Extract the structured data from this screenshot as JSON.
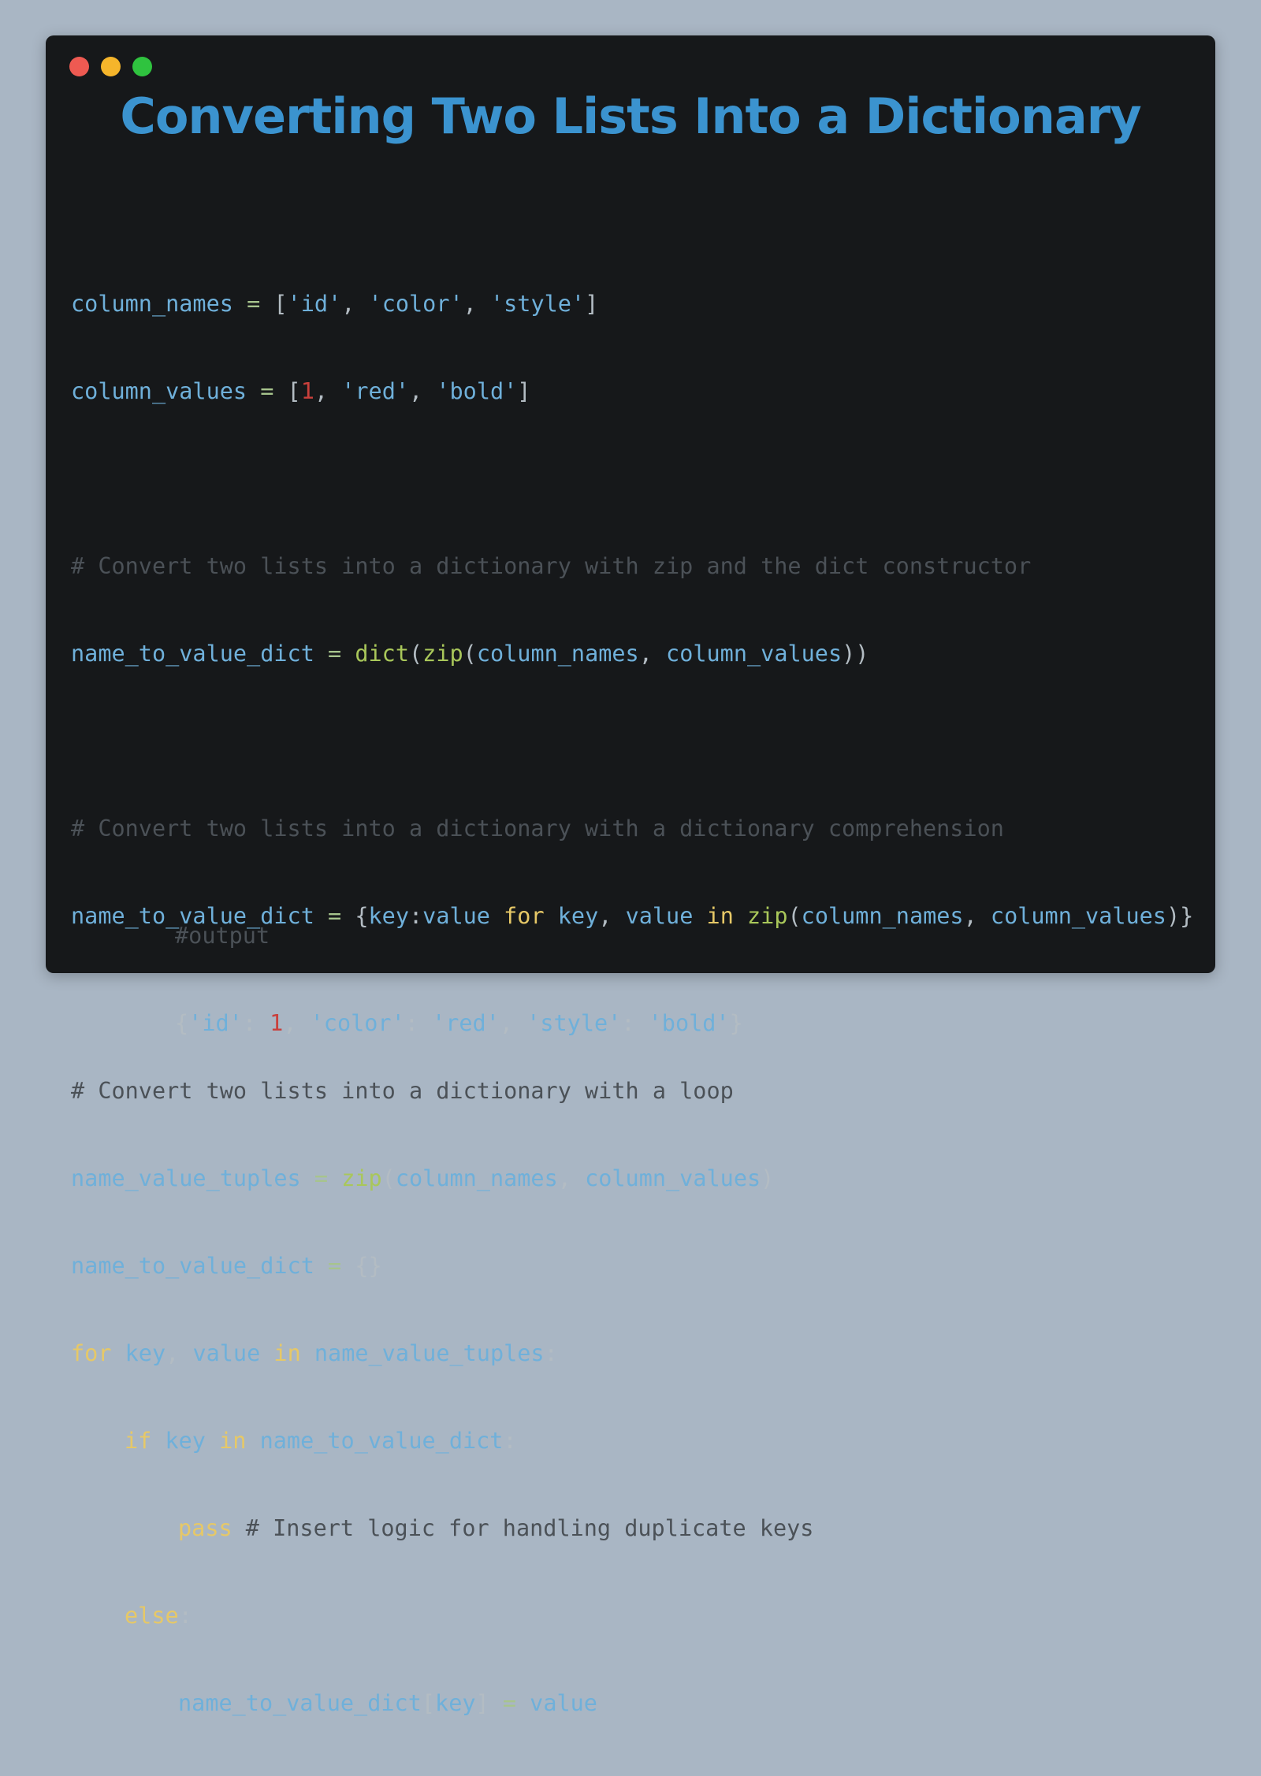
{
  "window": {
    "title": "Converting Two Lists Into a Dictionary",
    "controls": {
      "close_color": "#ee5a52",
      "minimize_color": "#f5b52b",
      "maximize_color": "#2fc33f"
    }
  },
  "code": {
    "l1": {
      "a": "column_names",
      "b": " = ",
      "c": "[",
      "d": "'id'",
      "e": ", ",
      "f": "'color'",
      "g": ", ",
      "h": "'style'",
      "i": "]"
    },
    "l2": {
      "a": "column_values",
      "b": " = ",
      "c": "[",
      "d": "1",
      "e": ", ",
      "f": "'red'",
      "g": ", ",
      "h": "'bold'",
      "i": "]"
    },
    "c1": "# Convert two lists into a dictionary with zip and the dict constructor",
    "l3": {
      "a": "name_to_value_dict",
      "b": " = ",
      "c": "dict",
      "d": "(",
      "e": "zip",
      "f": "(",
      "g": "column_names",
      "h": ", ",
      "i": "column_values",
      "j": "))"
    },
    "c2": "# Convert two lists into a dictionary with a dictionary comprehension",
    "l4": {
      "a": "name_to_value_dict",
      "b": " = ",
      "c": "{",
      "d": "key",
      "e": ":",
      "f": "value",
      "g": " for ",
      "h": "key",
      "i": ", ",
      "j": "value",
      "k": " in ",
      "l": "zip",
      "m": "(",
      "n": "column_names",
      "o": ", ",
      "p": "column_values",
      "q": ")}"
    },
    "c3": "# Convert two lists into a dictionary with a loop",
    "l5": {
      "a": "name_value_tuples",
      "b": " = ",
      "c": "zip",
      "d": "(",
      "e": "column_names",
      "f": ", ",
      "g": "column_values",
      "h": ")"
    },
    "l6": {
      "a": "name_to_value_dict",
      "b": " = ",
      "c": "{}"
    },
    "l7": {
      "a": "for",
      "b": " key",
      "c": ", ",
      "d": "value",
      "e": " in ",
      "f": "name_value_tuples",
      "g": ":"
    },
    "l8": {
      "a": "if",
      "b": " key",
      "c": " in ",
      "d": "name_to_value_dict",
      "e": ":"
    },
    "l9": {
      "a": "pass",
      "b": " # Insert logic for handling duplicate keys"
    },
    "l10": {
      "a": "else",
      "b": ":"
    },
    "l11": {
      "a": "name_to_value_dict",
      "b": "[",
      "c": "key",
      "d": "]",
      "e": " = ",
      "f": "value"
    }
  },
  "output": {
    "comment": "#output",
    "l": {
      "a": "{",
      "b": "'id'",
      "c": ": ",
      "d": "1",
      "e": ", ",
      "f": "'color'",
      "g": ": ",
      "h": "'red'",
      "i": ", ",
      "j": "'style'",
      "k": ": ",
      "l": "'bold'",
      "m": "}"
    }
  }
}
